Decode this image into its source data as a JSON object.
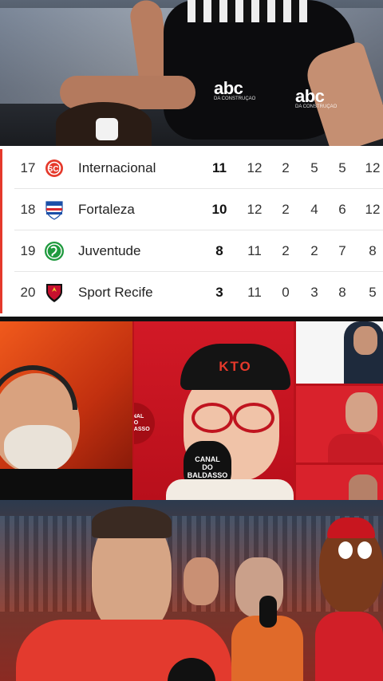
{
  "top_photo": {
    "sponsor_logos": [
      {
        "text": "abc",
        "subtext": "DA CONSTRUÇÃO"
      },
      {
        "text": "abc",
        "subtext": "DA CONSTRUÇÃO"
      }
    ]
  },
  "standings": {
    "rows": [
      {
        "pos": "17",
        "team": "Internacional",
        "crest": "internacional-crest-icon",
        "crest_color": "#e5392b",
        "pts": "11",
        "played": "12",
        "wins": "2",
        "draws": "5",
        "losses": "5",
        "goal_diff": "12"
      },
      {
        "pos": "18",
        "team": "Fortaleza",
        "crest": "fortaleza-crest-icon",
        "crest_color": "#1b4fa8",
        "pts": "10",
        "played": "12",
        "wins": "2",
        "draws": "4",
        "losses": "6",
        "goal_diff": "12"
      },
      {
        "pos": "19",
        "team": "Juventude",
        "crest": "juventude-crest-icon",
        "crest_color": "#1f9a3e",
        "pts": "8",
        "played": "11",
        "wins": "2",
        "draws": "2",
        "losses": "7",
        "goal_diff": "8"
      },
      {
        "pos": "20",
        "team": "Sport Recife",
        "crest": "sport-recife-crest-icon",
        "crest_color": "#c8102e",
        "pts": "3",
        "played": "11",
        "wins": "0",
        "draws": "3",
        "losses": "8",
        "goal_diff": "5"
      }
    ]
  },
  "broadcast": {
    "cap_logo": "KTO",
    "channel_logo": {
      "line1": "CANAL",
      "line2": "DO",
      "line3": "BALDASSO"
    },
    "mic_logo": {
      "line1": "CANAL",
      "line2": "DO",
      "line3": "BALDASSO"
    }
  },
  "colors": {
    "accent": "#e5392b",
    "broadcast_red": "#b9121b"
  }
}
